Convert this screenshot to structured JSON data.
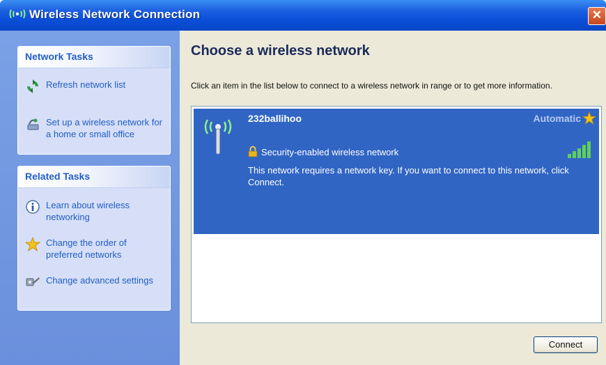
{
  "window": {
    "title": "Wireless Network Connection",
    "close_label": "✕"
  },
  "sidebar": {
    "network_tasks": {
      "title": "Network Tasks",
      "items": [
        {
          "label": "Refresh network list",
          "icon": "refresh-icon"
        },
        {
          "label": "Set up a wireless network for a home or small office",
          "icon": "wizard-icon"
        }
      ]
    },
    "related_tasks": {
      "title": "Related Tasks",
      "items": [
        {
          "label": "Learn about wireless networking",
          "icon": "info-icon"
        },
        {
          "label": "Change the order of preferred networks",
          "icon": "star-icon"
        },
        {
          "label": "Change advanced settings",
          "icon": "settings-icon"
        }
      ]
    }
  },
  "main": {
    "title": "Choose a wireless network",
    "instruction": "Click an item in the list below to connect to a wireless network in range or to get more information.",
    "networks": [
      {
        "name": "232ballihoo",
        "connection_type": "Automatic",
        "security": "Security-enabled wireless network",
        "description": "This network requires a network key. If you want to connect to this network, click Connect.",
        "signal_bars": 5
      }
    ],
    "connect_label": "Connect"
  },
  "colors": {
    "title_bar": "#0b4ed8",
    "sidebar": "#6a8fdc",
    "selected_item": "#3165c4",
    "task_link": "#215dc6"
  }
}
